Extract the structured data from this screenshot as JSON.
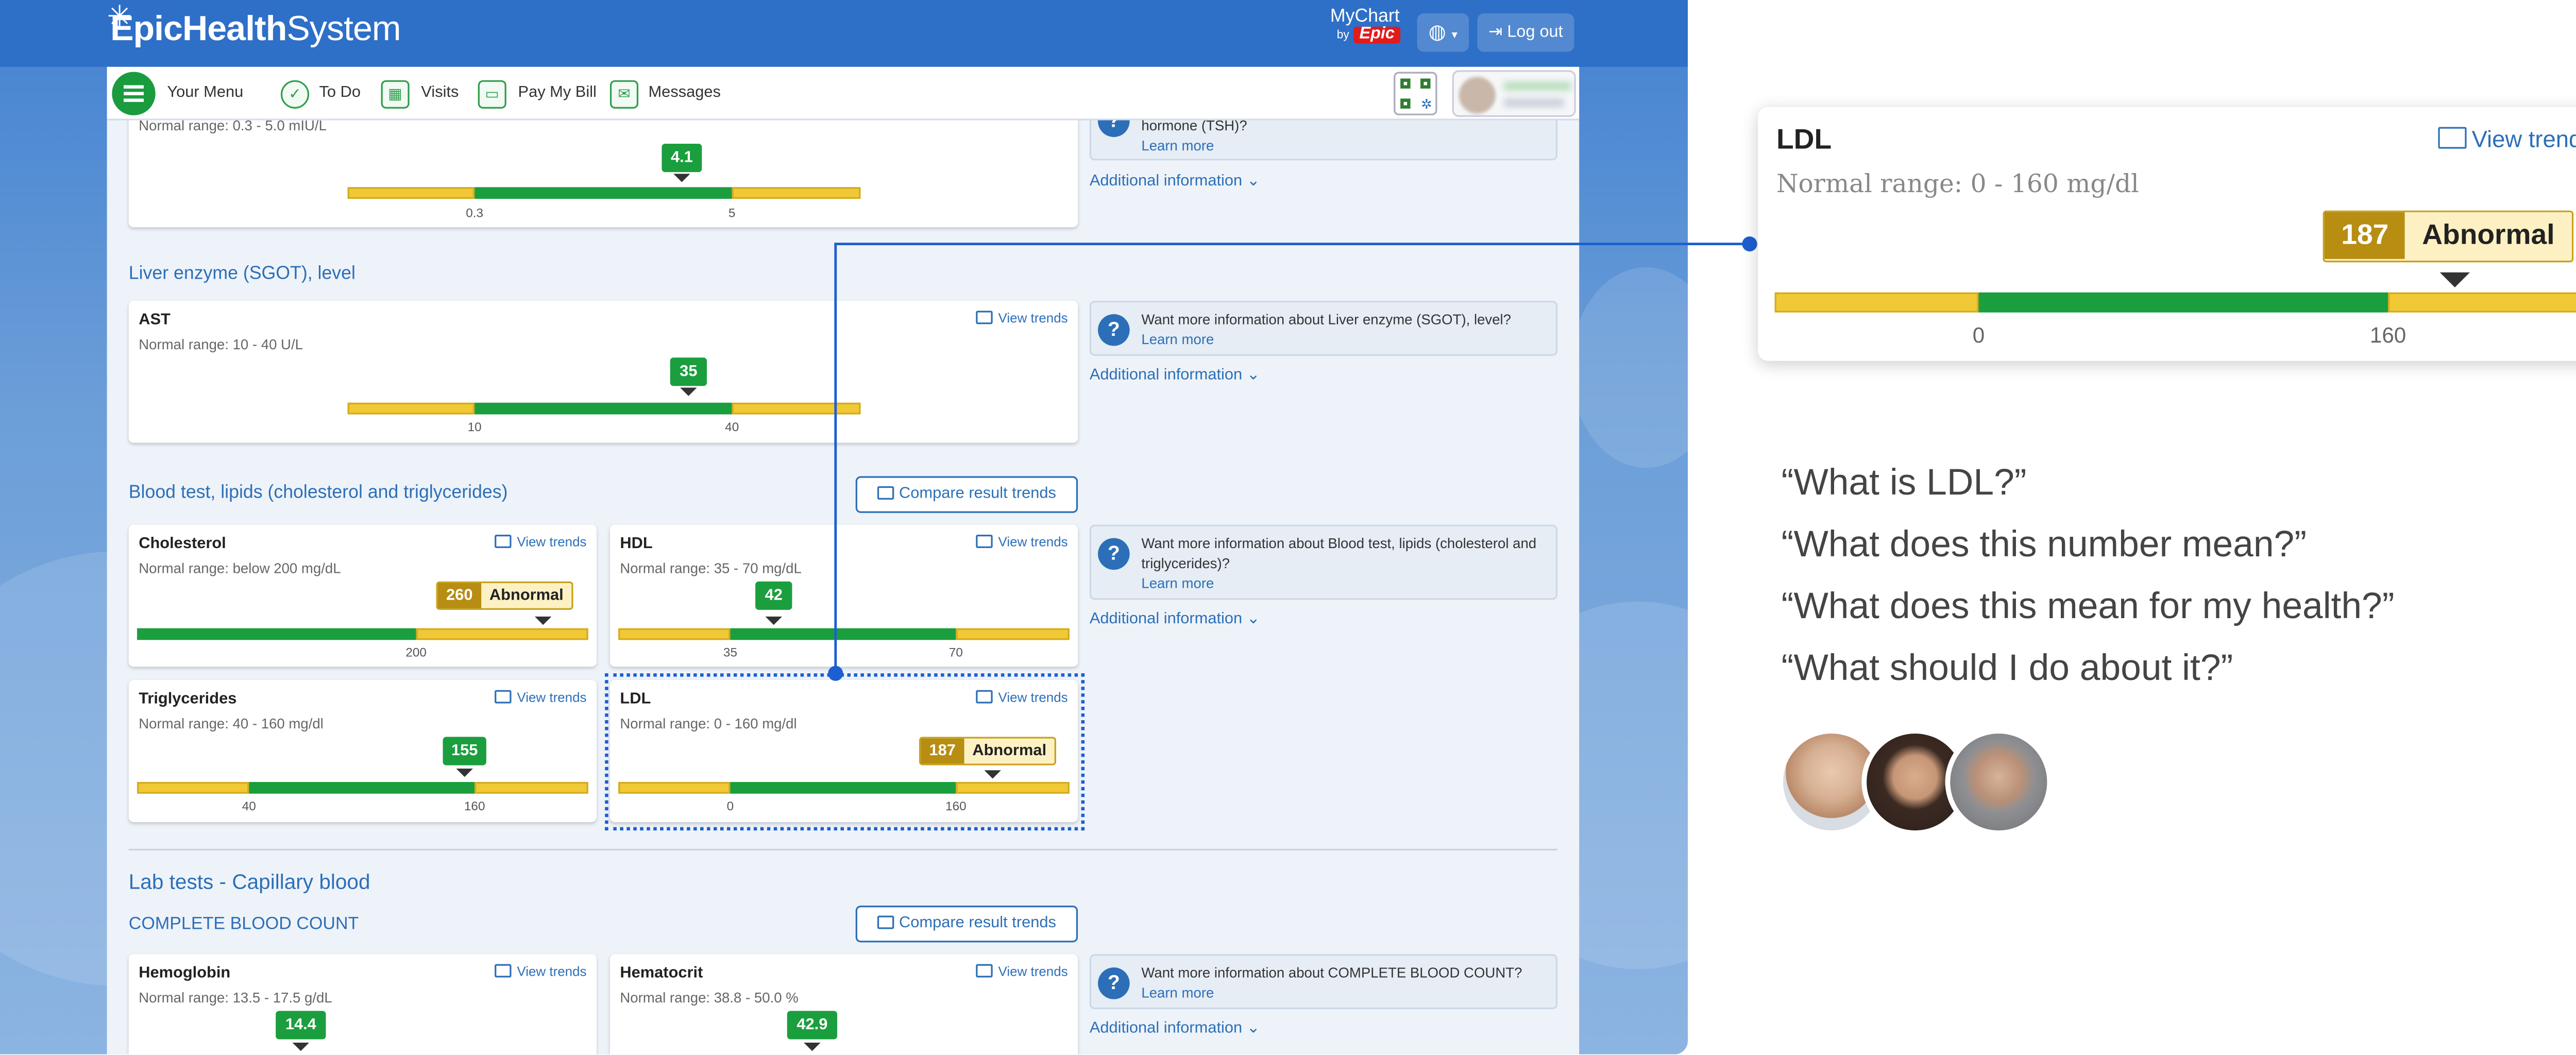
{
  "brand": {
    "name_bold": "Epic",
    "name_mid": "Health",
    "name_light": "System",
    "mychart_line1": "MyChart",
    "mychart_by": "by",
    "mychart_epic": "Epic"
  },
  "topbar": {
    "globe_icon": "globe-icon",
    "logout_label": "Log out"
  },
  "menubar": {
    "your_menu": "Your Menu",
    "items": [
      {
        "label": "To Do",
        "icon": "check-circle-icon"
      },
      {
        "label": "Visits",
        "icon": "calendar-icon"
      },
      {
        "label": "Pay My Bill",
        "icon": "credit-card-icon"
      },
      {
        "label": "Messages",
        "icon": "envelope-icon"
      }
    ]
  },
  "common": {
    "view_trends": "View trends",
    "compare_trends": "Compare result trends",
    "learn_more": "Learn more",
    "additional_info": "Additional information",
    "abnormal": "Abnormal"
  },
  "tsh": {
    "range": "Normal range: 0.3 - 5.0 mIU/L",
    "value": "4.1",
    "ticks": [
      "0.3",
      "5"
    ],
    "info_text": "hormone (TSH)?",
    "value_num": 4.1
  },
  "liver": {
    "section": "Liver enzyme (SGOT), level",
    "card": {
      "name": "AST",
      "range": "Normal range: 10 - 40 U/L",
      "value": "35",
      "ticks": [
        "10",
        "40"
      ]
    },
    "info_text": "Want more information about Liver enzyme (SGOT), level?"
  },
  "lipids": {
    "section": "Blood test, lipids (cholesterol and triglycerides)",
    "info_text": "Want more information about Blood test, lipids (cholesterol and triglycerides)?",
    "cholesterol": {
      "name": "Cholesterol",
      "range": "Normal range: below 200 mg/dL",
      "value": "260",
      "ticks": [
        "200"
      ]
    },
    "hdl": {
      "name": "HDL",
      "range": "Normal range: 35 - 70 mg/dL",
      "value": "42",
      "ticks": [
        "35",
        "70"
      ]
    },
    "triglycerides": {
      "name": "Triglycerides",
      "range": "Normal range: 40 - 160 mg/dl",
      "value": "155",
      "ticks": [
        "40",
        "160"
      ]
    },
    "ldl": {
      "name": "LDL",
      "range": "Normal range: 0 - 160 mg/dl",
      "value": "187",
      "ticks": [
        "0",
        "160"
      ]
    }
  },
  "capillary": {
    "title": "Lab tests - Capillary blood",
    "section": "COMPLETE BLOOD COUNT",
    "info_text": "Want more information about COMPLETE BLOOD COUNT?",
    "hemoglobin": {
      "name": "Hemoglobin",
      "range": "Normal range: 13.5 - 17.5 g/dL",
      "value": "14.4"
    },
    "hematocrit": {
      "name": "Hematocrit",
      "range": "Normal range: 38.8 - 50.0 %",
      "value": "42.9"
    }
  },
  "zoom": {
    "name": "LDL",
    "range": "Normal range: 0 - 160 mg/dl",
    "value": "187",
    "status": "Abnormal",
    "ticks": [
      "0",
      "160"
    ],
    "view_trends": "View trends"
  },
  "questions": [
    "“What is LDL?”",
    "“What does this number mean?”",
    "“What does this mean for my health?”",
    "“What should I do about it?”"
  ],
  "colors": {
    "accent": "#2c6fb8",
    "normal": "#1b9e3e",
    "out_of_range": "#f1c835",
    "abnormal_badge": "#b78d12",
    "highlight": "#1c5fd0"
  }
}
